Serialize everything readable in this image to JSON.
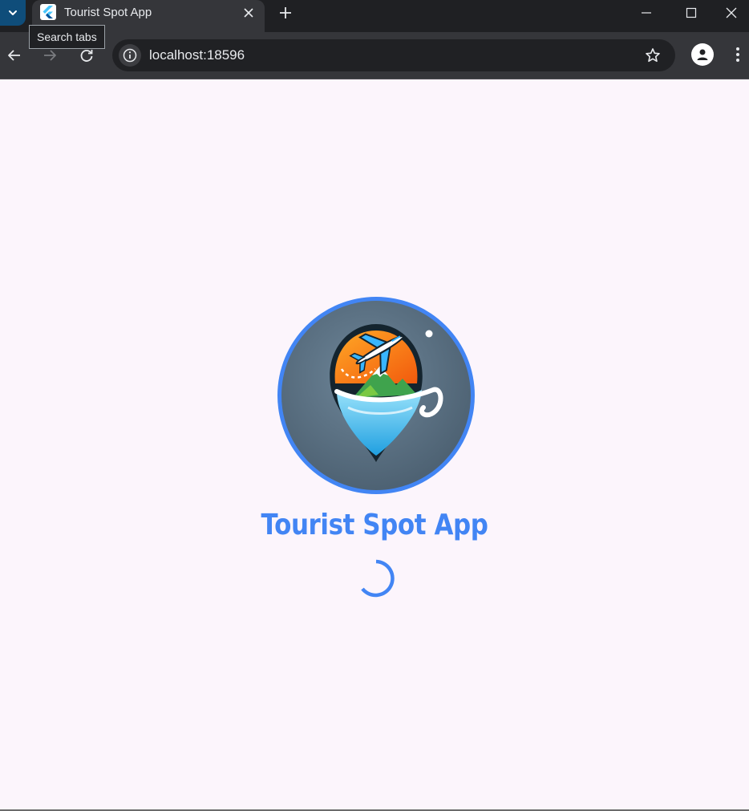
{
  "browser": {
    "tab": {
      "title": "Tourist Spot App",
      "favicon": "flutter-icon"
    },
    "tooltip": "Search tabs",
    "address_bar": {
      "url": "localhost:18596"
    },
    "icons": {
      "tab_search": "chevron-down-icon",
      "close_tab": "close-icon",
      "new_tab": "plus-icon",
      "minimize": "minimize-icon",
      "maximize": "maximize-icon",
      "close_window": "close-icon",
      "back": "arrow-left-icon",
      "forward": "arrow-right-icon",
      "reload": "reload-icon",
      "site_info": "info-icon",
      "bookmark": "star-icon",
      "profile": "profile-icon",
      "menu": "kebab-menu-icon"
    }
  },
  "app": {
    "title": "Tourist Spot App",
    "logo": "travel-pin-logo",
    "loading": true,
    "colors": {
      "accent": "#4285f4",
      "background": "#fcf5fc"
    }
  }
}
